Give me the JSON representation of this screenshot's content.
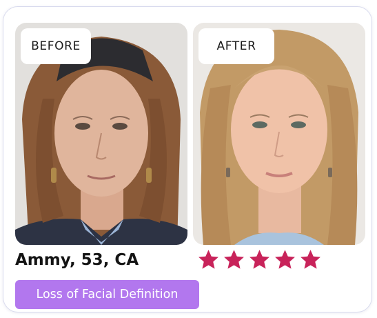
{
  "labels": {
    "before": "BEFORE",
    "after": "AFTER"
  },
  "photos": {
    "before": "portrait of an older woman with auburn hair and a black headband, before treatment",
    "after": "portrait of the same woman with smoother skin and blonde hair, after treatment"
  },
  "customer": {
    "name": "Ammy, 53, CA"
  },
  "rating": {
    "stars": 5,
    "max": 5,
    "color": "#c8235a"
  },
  "tag": {
    "text": "Loss of Facial Definition",
    "color": "#b277ee"
  },
  "icons": [
    "star-icon"
  ]
}
